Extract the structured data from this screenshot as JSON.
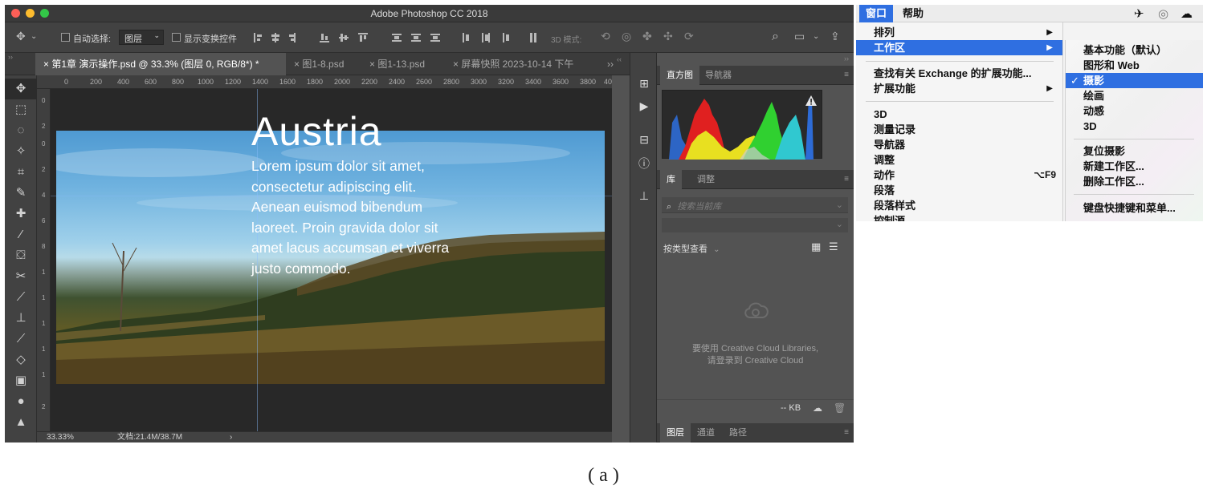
{
  "photoshop": {
    "window_title": "Adobe Photoshop CC 2018",
    "options": {
      "auto_select_label": "自动选择:",
      "auto_select_value": "图层",
      "show_transform_label": "显示变换控件",
      "mode_3d_label": "3D 模式:"
    },
    "tabs": [
      {
        "label": "× 第1章 演示操作.psd @ 33.3% (图层 0, RGB/8*) *",
        "active": true
      },
      {
        "label": "× 图1-8.psd",
        "active": false
      },
      {
        "label": "× 图1-13.psd",
        "active": false
      },
      {
        "label": "× 屏幕快照 2023-10-14 下午",
        "active": false
      }
    ],
    "tabs_overflow": "››",
    "ruler_h_ticks": [
      "0",
      "200",
      "400",
      "600",
      "800",
      "1000",
      "1200",
      "1400",
      "1600",
      "1800",
      "2000",
      "2200",
      "2400",
      "2600",
      "2800",
      "3000",
      "3200",
      "3400",
      "3600",
      "3800",
      "40"
    ],
    "ruler_v_ticks": [
      "0",
      "2",
      "0",
      "2",
      "4",
      "6",
      "8",
      "1",
      "1",
      "1",
      "1",
      "1",
      "2"
    ],
    "artwork": {
      "headline": "Austria",
      "body": "Lorem ipsum dolor sit amet, consectetur adipiscing elit. Aenean euismod bibendum laoreet. Proin gravida dolor sit amet lacus accumsan et viverra justo commodo."
    },
    "status": {
      "zoom": "33.33%",
      "doc_info": "文档:21.4M/38.7M",
      "arrow": "›"
    },
    "panels": {
      "top_tabs": [
        "直方图",
        "导航器"
      ],
      "library_tabs": [
        "库",
        "调整"
      ],
      "search_placeholder": "搜索当前库",
      "view_by": "按类型查看",
      "cc_message_line1": "要使用 Creative Cloud Libraries,",
      "cc_message_line2": "请登录到 Creative Cloud",
      "size": "-- KB",
      "bottom_tabs": [
        "图层",
        "通道",
        "路径"
      ]
    },
    "tools": [
      "move-tool",
      "marquee-tool",
      "lasso-tool",
      "magic-wand-tool",
      "crop-tool",
      "eyedropper-tool",
      "healing-brush-tool",
      "brush-tool",
      "clone-stamp-tool",
      "history-brush-tool",
      "eraser-tool",
      "gradient-tool",
      "blur-tool",
      "dodge-tool",
      "pen-tool",
      "type-tool",
      "path-select-tool"
    ]
  },
  "mac_menu": {
    "menubar": [
      "窗口",
      "帮助"
    ],
    "window_menu_items": [
      {
        "label": "排列",
        "submenu": true
      },
      {
        "label": "工作区",
        "submenu": true,
        "highlighted": true
      },
      {
        "label": "查找有关 Exchange 的扩展功能...",
        "submenu": false
      },
      {
        "label": "扩展功能",
        "submenu": true
      },
      {
        "label": "3D"
      },
      {
        "label": "测量记录"
      },
      {
        "label": "导航器"
      },
      {
        "label": "调整"
      },
      {
        "label": "动作",
        "shortcut": "⌥F9"
      },
      {
        "label": "段落"
      },
      {
        "label": "段落样式"
      },
      {
        "label": "控制源"
      }
    ],
    "workspace_submenu": [
      {
        "label": "基本功能（默认）"
      },
      {
        "label": "图形和 Web"
      },
      {
        "label": "摄影",
        "checked": true,
        "highlighted": true
      },
      {
        "label": "绘画"
      },
      {
        "label": "动感"
      },
      {
        "label": "3D"
      },
      {
        "label": "复位摄影"
      },
      {
        "label": "新建工作区..."
      },
      {
        "label": "删除工作区..."
      },
      {
        "label": "键盘快捷键和菜单..."
      }
    ],
    "check_mark": "✓",
    "submenu_arrow": "▶"
  },
  "caption": "( a )",
  "colors": {
    "highlight": "#2f6fe1",
    "ps_dark": "#424242",
    "ps_mid": "#535353"
  }
}
